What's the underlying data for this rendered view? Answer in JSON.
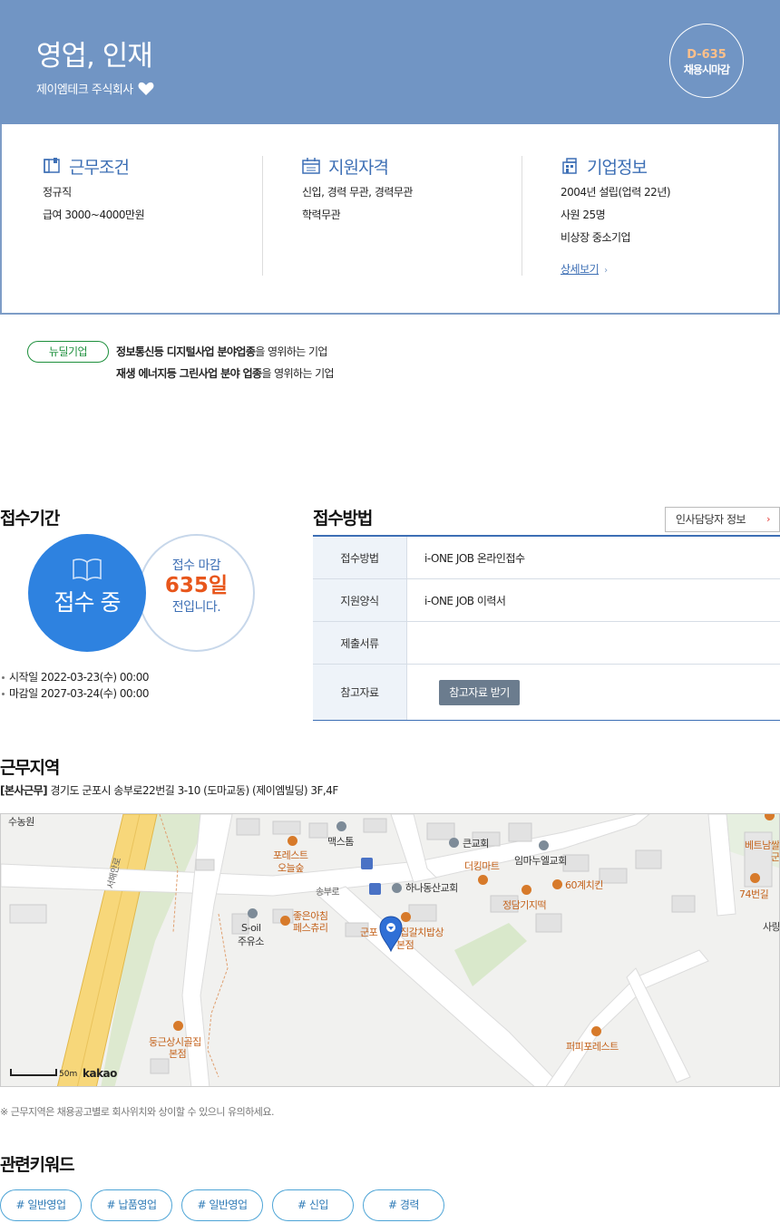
{
  "header": {
    "title": "영업, 인재",
    "company": "제이엠테크 주식회사",
    "dday": "D-635",
    "dday_label": "채용시마감"
  },
  "conditions": {
    "title": "근무조건",
    "lines": [
      "정규직",
      "급여 3000~4000만원"
    ]
  },
  "qualification": {
    "title": "지원자격",
    "lines": [
      "신입, 경력 무관, 경력무관",
      "학력무관"
    ]
  },
  "company_info": {
    "title": "기업정보",
    "lines": [
      "2004년 설립(업력 22년)",
      "사원 25명",
      "비상장 중소기업"
    ],
    "more_link": "상세보기"
  },
  "new_deal": {
    "badge": "뉴딜기업",
    "line1_bold": "정보통신등 디지털사업 분야업종",
    "line1_rest": "을 영위하는 기업",
    "line2_bold": "재생 에너지등 그린사업 분야 업종",
    "line2_rest": "을 영위하는 기업"
  },
  "period": {
    "title": "접수기간",
    "status": "접수 중",
    "deadline_line1": "접수 마감",
    "deadline_days": "635일",
    "deadline_line3": "전입니다.",
    "start": "시작일 2022-03-23(수) 00:00",
    "end": "마감일 2027-03-24(수) 00:00"
  },
  "method": {
    "title": "접수방법",
    "hr_button": "인사담당자 정보",
    "rows": [
      {
        "label": "접수방법",
        "value": "i-ONE JOB 온라인접수"
      },
      {
        "label": "지원양식",
        "value": "i-ONE JOB 이력서"
      },
      {
        "label": "제출서류",
        "value": ""
      },
      {
        "label": "참고자료",
        "value": ""
      }
    ],
    "ref_button": "참고자료 받기"
  },
  "location": {
    "title": "근무지역",
    "tag": "[본사근무]",
    "address": "경기도 군포시 송부로22번길 3-10 (도마교동) (제이엠빌딩) 3F,4F",
    "note": "※ 근무지역은 채용공고별로 회사위치와 상이할 수 있으니 유의하세요."
  },
  "map": {
    "labels": {
      "sunongwon": "수농원",
      "forest": "포레스트",
      "oneulsup": "오늘숲",
      "maektom": "맥스톰",
      "keungyohoe": "큰교회",
      "immanuel": "임마누엘교회",
      "thekingmart": "더킹마트",
      "hana": "하나동산교회",
      "sixty": "60계치킨",
      "jeongdam": "정담기지떡",
      "songburo": "송부로",
      "soil1": "S-oil",
      "soil2": "주유소",
      "joeun1": "좋은아침",
      "joeun2": "페스츄리",
      "gunpo": "군포",
      "galbi1": "집갈치밥상",
      "galbi2": "본점",
      "dunggeun1": "둥근상시골집",
      "dunggeun2": "본점",
      "puffy": "퍼피포레스트",
      "vietnam": "베트남쌀",
      "gun": "군",
      "seventyfour": "74번길",
      "sar": "사랑",
      "road": "서해안로"
    },
    "scale": "50m",
    "brand": "kakao"
  },
  "keywords": {
    "title": "관련키워드",
    "items": [
      "# 일반영업",
      "# 납품영업",
      "# 일반영업",
      "# 신입",
      "# 경력"
    ]
  }
}
